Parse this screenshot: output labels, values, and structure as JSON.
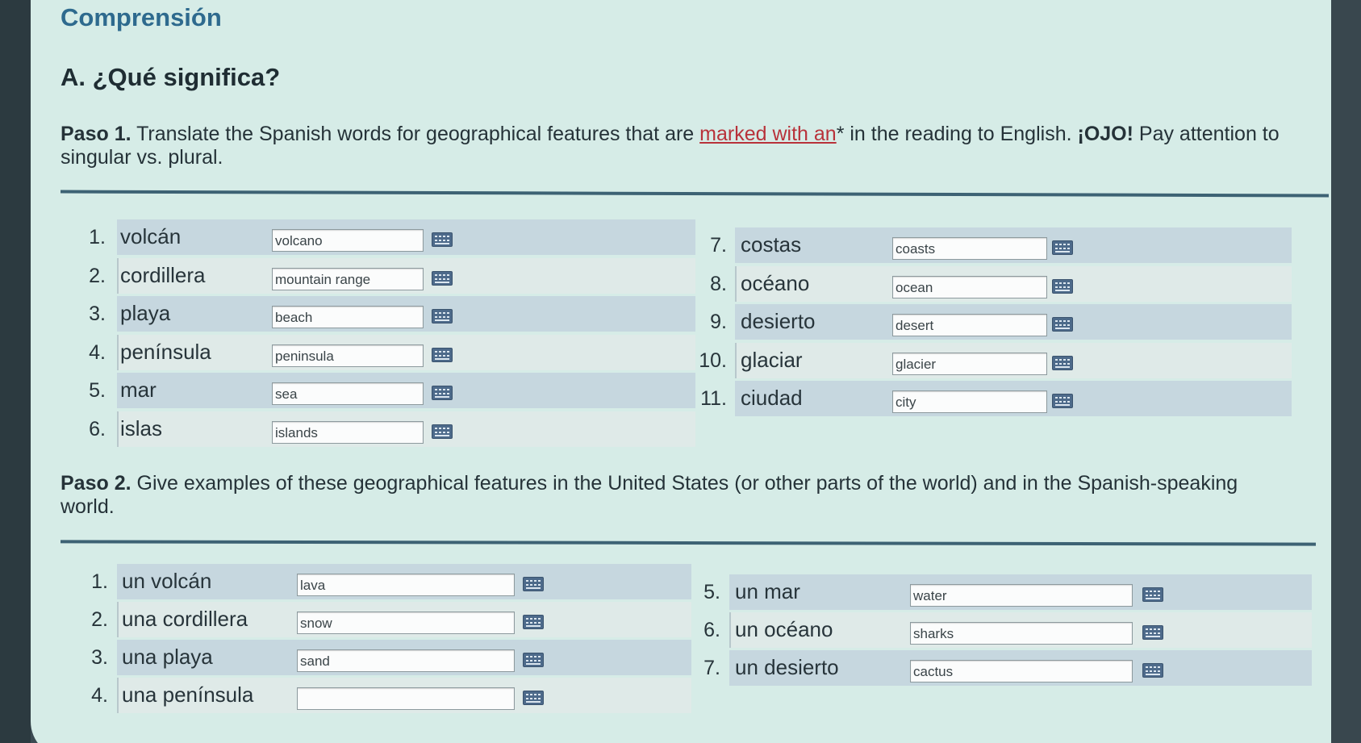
{
  "heading": "Comprensión",
  "section_a": "A. ¿Qué significa?",
  "paso1": {
    "label": "Paso 1.",
    "text_before": "Translate the Spanish words for geographical features that are",
    "link_text": "marked with an",
    "text_after": "* in the reading to English.",
    "ojo": "¡OJO!",
    "text_end": "Pay attention to singular vs. plural."
  },
  "paso1_items_left": [
    {
      "num": "1.",
      "word": "volcán",
      "answer": "volcano"
    },
    {
      "num": "2.",
      "word": "cordillera",
      "answer": "mountain range"
    },
    {
      "num": "3.",
      "word": "playa",
      "answer": "beach"
    },
    {
      "num": "4.",
      "word": "península",
      "answer": "peninsula"
    },
    {
      "num": "5.",
      "word": "mar",
      "answer": "sea"
    },
    {
      "num": "6.",
      "word": "islas",
      "answer": "islands"
    }
  ],
  "paso1_items_right": [
    {
      "num": "7.",
      "word": "costas",
      "answer": "coasts"
    },
    {
      "num": "8.",
      "word": "océano",
      "answer": "ocean"
    },
    {
      "num": "9.",
      "word": "desierto",
      "answer": "desert"
    },
    {
      "num": "10.",
      "word": "glaciar",
      "answer": "glacier"
    },
    {
      "num": "11.",
      "word": "ciudad",
      "answer": "city"
    }
  ],
  "paso2": {
    "label": "Paso 2.",
    "text": "Give examples of these geographical features in the United States (or other parts of the world) and in the Spanish-speaking world."
  },
  "paso2_items_left": [
    {
      "num": "1.",
      "word": "un volcán",
      "answer": "lava"
    },
    {
      "num": "2.",
      "word": "una cordillera",
      "answer": "snow"
    },
    {
      "num": "3.",
      "word": "una playa",
      "answer": "sand"
    },
    {
      "num": "4.",
      "word": "una península",
      "answer": ""
    }
  ],
  "paso2_items_right": [
    {
      "num": "5.",
      "word": "un mar",
      "answer": "water"
    },
    {
      "num": "6.",
      "word": "un océano",
      "answer": "sharks"
    },
    {
      "num": "7.",
      "word": "un desierto",
      "answer": "cactus"
    }
  ],
  "keyboard_icon": "keyboard-icon",
  "colors": {
    "heading": "#2e6a8e",
    "link": "#b8323a",
    "band_dark": "#c6d7df",
    "card_bg": "#d6ece7"
  }
}
